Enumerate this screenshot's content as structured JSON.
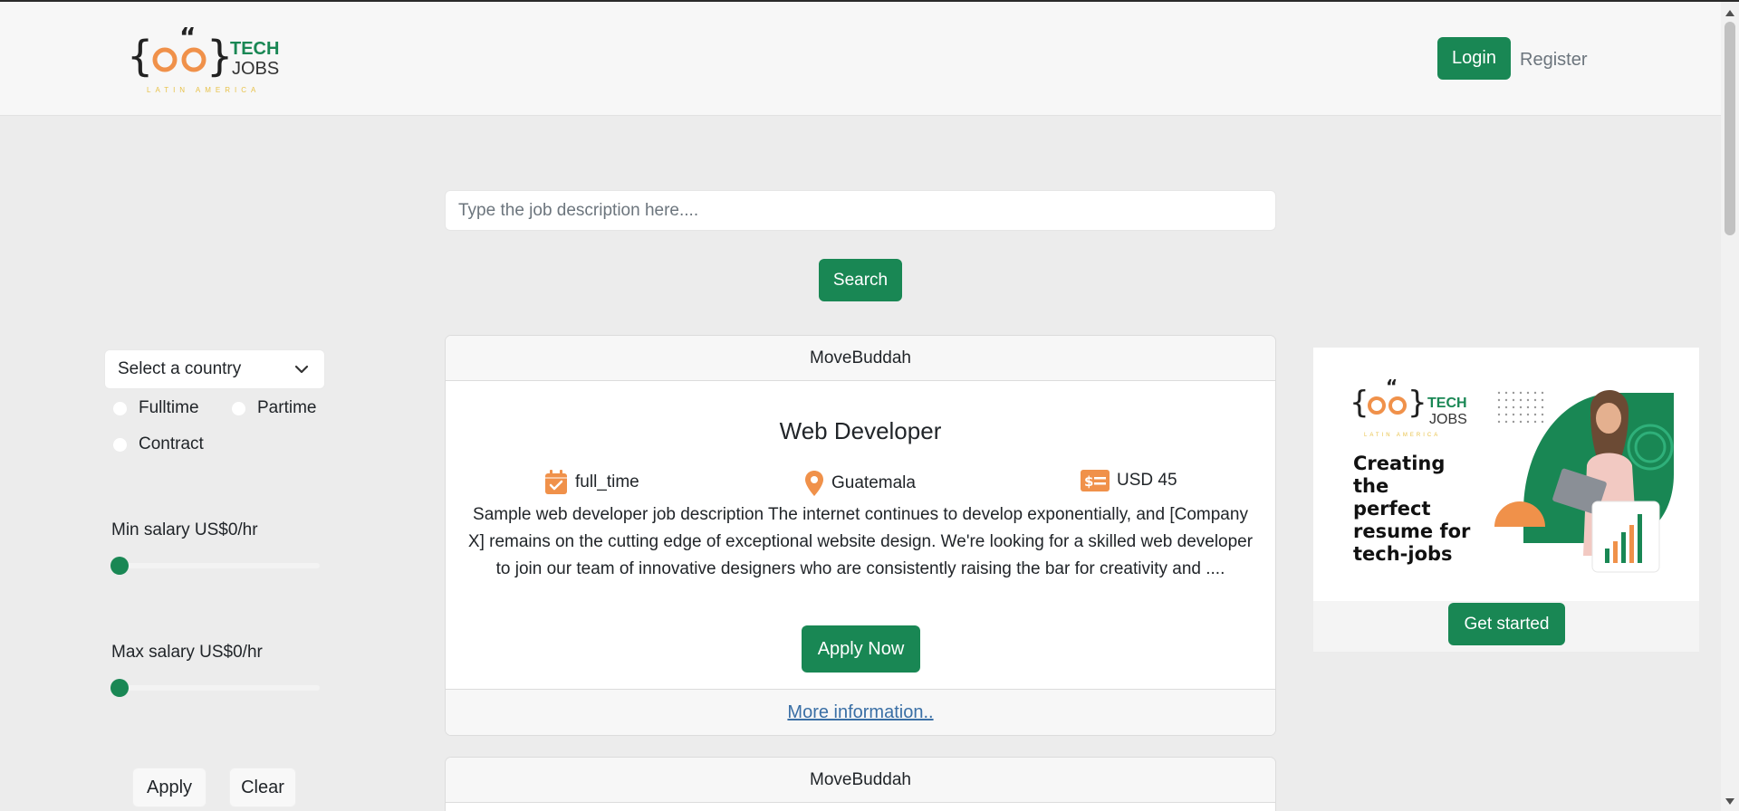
{
  "header": {
    "logo": {
      "word1": "TECH",
      "word2": "JOBS",
      "tagline": "LATIN AMERICA"
    },
    "login_label": "Login",
    "register_label": "Register"
  },
  "search": {
    "placeholder": "Type the job description here....",
    "button_label": "Search"
  },
  "filters": {
    "country_select": "Select a country",
    "job_types": [
      "Fulltime",
      "Partime",
      "Contract"
    ],
    "min_salary_label": "Min salary US$0/hr",
    "max_salary_label": "Max salary US$0/hr",
    "min_salary_value": 0,
    "max_salary_value": 0,
    "apply_label": "Apply",
    "clear_label": "Clear"
  },
  "jobs": [
    {
      "company": "MoveBuddah",
      "title": "Web Developer",
      "type": "full_time",
      "location": "Guatemala",
      "salary": "USD 45",
      "description": "Sample web developer job description The internet continues to develop exponentially, and [Company X] remains on the cutting edge of exceptional website design. We're looking for a skilled web developer to join our team of innovative designers who are consistently raising the bar for creativity and ....",
      "apply_label": "Apply Now",
      "more_info_label": "More information.."
    },
    {
      "company": "MoveBuddah"
    }
  ],
  "ad": {
    "logo_word1": "TECH",
    "logo_word2": "JOBS",
    "logo_tagline": "LATIN AMERICA",
    "headline_lines": [
      "Creating",
      "the",
      "perfect",
      "resume for",
      "tech-jobs"
    ],
    "button_label": "Get started"
  },
  "colors": {
    "brand_green": "#198754",
    "brand_orange": "#f0914a",
    "link_blue": "#3a6fa5"
  },
  "icons": {
    "job_type": "calendar-check-icon",
    "location": "map-pin-icon",
    "salary": "money-bill-icon",
    "select": "chevron-down-icon"
  }
}
